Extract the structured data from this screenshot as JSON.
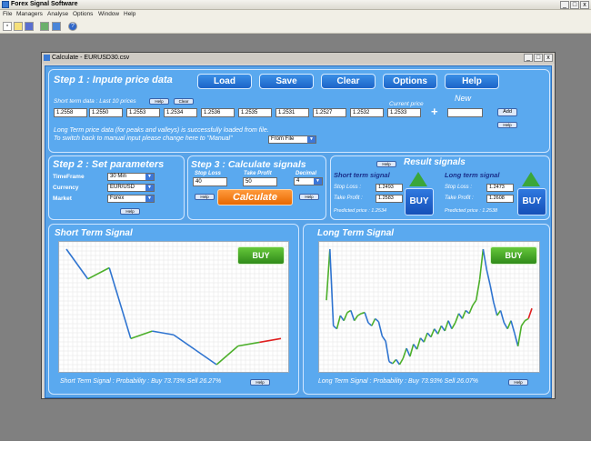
{
  "app": {
    "title": "Forex Signal Software",
    "menu": [
      "File",
      "Managers",
      "Analyse",
      "Options",
      "Window",
      "Help"
    ],
    "window_controls": [
      "_",
      "□",
      "x"
    ]
  },
  "toolbar": {
    "icons": [
      "new-icon",
      "open-icon",
      "save-icon",
      "managers-icon",
      "calculate-icon",
      "help-icon"
    ]
  },
  "calc_window": {
    "title": "Calculate - EURUSD30.csv",
    "controls": [
      "_",
      "□",
      "x"
    ]
  },
  "step1": {
    "title": "Step 1 : Inpute price data",
    "load_label": "Load",
    "save_label": "Save",
    "clear_label": "Clear",
    "options_label": "Options",
    "help_label": "Help",
    "short_term_label": "Short term data : Last 10 prices",
    "help_small": "Help",
    "clear_small": "Clear",
    "current_price_label": "Current price",
    "new_label": "New",
    "plus": "+",
    "add_label": "Add",
    "prices": [
      "1.2558",
      "1.2550",
      "1.2553",
      "1.2534",
      "1.2536",
      "1.2535",
      "1.2531",
      "1.2527",
      "1.2532",
      "1.2533"
    ],
    "new_value": "",
    "info_line1": "Long Term price data (for peaks and valleys) is successfully loaded from file.",
    "info_line2": "To switch back to manual input please change here to \"Manual\"",
    "source_value": "From File"
  },
  "step2": {
    "title": "Step 2 : Set parameters",
    "timeframe_label": "TimeFrame",
    "timeframe_value": "30 Min",
    "currency_label": "Currency",
    "currency_value": "EUR/USD",
    "market_label": "Market",
    "market_value": "Forex",
    "help_label": "Help"
  },
  "step3": {
    "title": "Step 3 : Calculate signals",
    "stop_loss_label": "Stop Loss",
    "stop_loss_value": "40",
    "take_profit_label": "Take Profit",
    "take_profit_value": "50",
    "decimal_label": "Decimal",
    "decimal_value": "4",
    "help_label": "Help",
    "calculate_label": "Calculate"
  },
  "results": {
    "title": "Result signals",
    "help_label": "Help",
    "short": {
      "title": "Short term signal",
      "stop_loss_label": "Stop Loss :",
      "stop_loss_value": "1.2493",
      "take_profit_label": "Take Profit :",
      "take_profit_value": "1.2583",
      "predicted": "Predicted price : 1.2534",
      "signal": "BUY"
    },
    "long": {
      "title": "Long term signal",
      "stop_loss_label": "Stop Loss :",
      "stop_loss_value": "1.2473",
      "take_profit_label": "Take Profit :",
      "take_profit_value": "1.2608",
      "predicted": "Predicted price : 1.2538",
      "signal": "BUY"
    }
  },
  "short_chart": {
    "title": "Short Term Signal",
    "signal": "BUY",
    "footer": "Short Term Signal : Probability : Buy 73.73% Sell 26.27%",
    "help_label": "Help"
  },
  "long_chart": {
    "title": "Long Term Signal",
    "signal": "BUY",
    "footer": "Long Term Signal : Probability : Buy 73.93% Sell 26.07%",
    "help_label": "Help"
  },
  "chart_data": [
    {
      "type": "line",
      "x": [
        1,
        2,
        3,
        4,
        5,
        6,
        7,
        8,
        9,
        10,
        11
      ],
      "values": [
        1.2558,
        1.255,
        1.2553,
        1.2534,
        1.2536,
        1.2535,
        1.2531,
        1.2527,
        1.2532,
        1.2533,
        1.2534
      ],
      "grid": true,
      "colors": {
        "up": "#4caf2a",
        "down": "#2f74d0",
        "prediction": "#e02020"
      }
    },
    {
      "type": "line",
      "x": [
        1,
        2,
        3,
        4,
        5,
        6,
        7,
        8,
        9,
        10,
        11,
        12,
        13,
        14,
        15,
        16,
        17,
        18,
        19,
        20,
        21,
        22,
        23,
        24,
        25,
        26,
        27,
        28,
        29,
        30,
        31,
        32,
        33,
        34,
        35,
        36,
        37,
        38,
        39,
        40,
        41,
        42,
        43,
        44,
        45,
        46,
        47,
        48,
        49,
        50,
        51,
        52,
        53,
        54,
        55,
        56,
        57,
        58,
        59,
        60
      ],
      "values": [
        1.254,
        1.259,
        1.2515,
        1.2512,
        1.2525,
        1.252,
        1.2528,
        1.253,
        1.252,
        1.2525,
        1.2527,
        1.2528,
        1.2518,
        1.2515,
        1.2522,
        1.2519,
        1.2505,
        1.25,
        1.248,
        1.2478,
        1.2482,
        1.2477,
        1.2483,
        1.2493,
        1.2485,
        1.2497,
        1.2492,
        1.2503,
        1.2499,
        1.2508,
        1.2504,
        1.2512,
        1.2507,
        1.2515,
        1.251,
        1.252,
        1.2512,
        1.2518,
        1.2527,
        1.2522,
        1.253,
        1.2527,
        1.2535,
        1.254,
        1.256,
        1.259,
        1.257,
        1.2555,
        1.2538,
        1.2525,
        1.253,
        1.2518,
        1.2512,
        1.252,
        1.2508,
        1.2495,
        1.2515,
        1.252,
        1.2522,
        1.2532
      ],
      "grid": true,
      "colors": {
        "up": "#4caf2a",
        "down": "#2f74d0",
        "prediction": "#e02020"
      }
    }
  ]
}
